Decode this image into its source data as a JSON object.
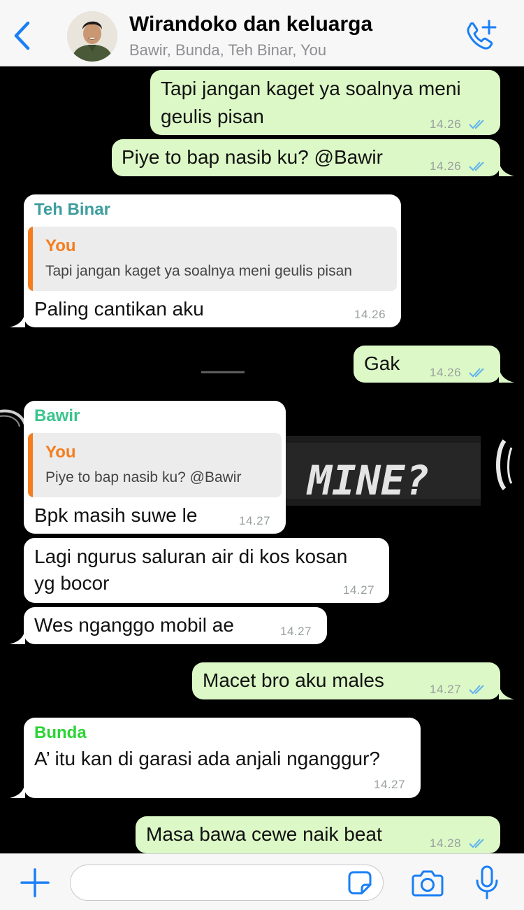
{
  "header": {
    "back_icon": "chevron-left-icon",
    "title": "Wirandoko dan keluarga",
    "subtitle": "Bawir, Bunda, Teh Binar, You",
    "call_icon": "phone-add-icon"
  },
  "colors": {
    "accent": "#1a7ff5",
    "outgoing_bubble": "#dcf8c6",
    "incoming_bubble": "#ffffff",
    "sender_teh_binar": "#3e9e9e",
    "sender_bawir": "#3bc48d",
    "sender_bunda": "#2bd435",
    "quote_you": "#f47d1e",
    "read_ticks": "#5fb2ee"
  },
  "background": {
    "label": "MINE?"
  },
  "messages": [
    {
      "dir": "out",
      "lines": [
        "Tapi jangan kaget ya soalnya meni",
        "geulis pisan"
      ],
      "time": "14.26"
    },
    {
      "dir": "out",
      "lines": [
        "Piye to bap nasib ku? @Bawir"
      ],
      "time": "14.26"
    },
    {
      "dir": "in",
      "sender": "Teh Binar",
      "quote": {
        "name": "You",
        "text": "Tapi jangan kaget ya soalnya meni geulis pisan"
      },
      "lines": [
        "Paling cantikan aku"
      ],
      "time": "14.26"
    },
    {
      "dir": "out",
      "lines": [
        "Gak"
      ],
      "time": "14.26"
    },
    {
      "dir": "in",
      "sender": "Bawir",
      "quote": {
        "name": "You",
        "text": "Piye to bap nasib ku? @Bawir"
      },
      "lines": [
        "Bpk masih suwe le"
      ],
      "time": "14.27"
    },
    {
      "dir": "in",
      "lines": [
        "Lagi ngurus saluran air di kos kosan",
        "yg bocor"
      ],
      "time": "14.27"
    },
    {
      "dir": "in",
      "lines": [
        "Wes nganggo mobil ae"
      ],
      "time": "14.27"
    },
    {
      "dir": "out",
      "lines": [
        "Macet bro aku males"
      ],
      "time": "14.27"
    },
    {
      "dir": "in",
      "sender": "Bunda",
      "lines": [
        "A’ itu kan di garasi ada anjali nganggur?"
      ],
      "time": "14.27"
    },
    {
      "dir": "out",
      "lines": [
        "Masa bawa cewe naik beat"
      ],
      "time": "14.28"
    }
  ],
  "composer": {
    "plus_icon": "plus-icon",
    "input_value": "",
    "sticker_icon": "sticker-icon",
    "camera_icon": "camera-icon",
    "mic_icon": "microphone-icon"
  }
}
